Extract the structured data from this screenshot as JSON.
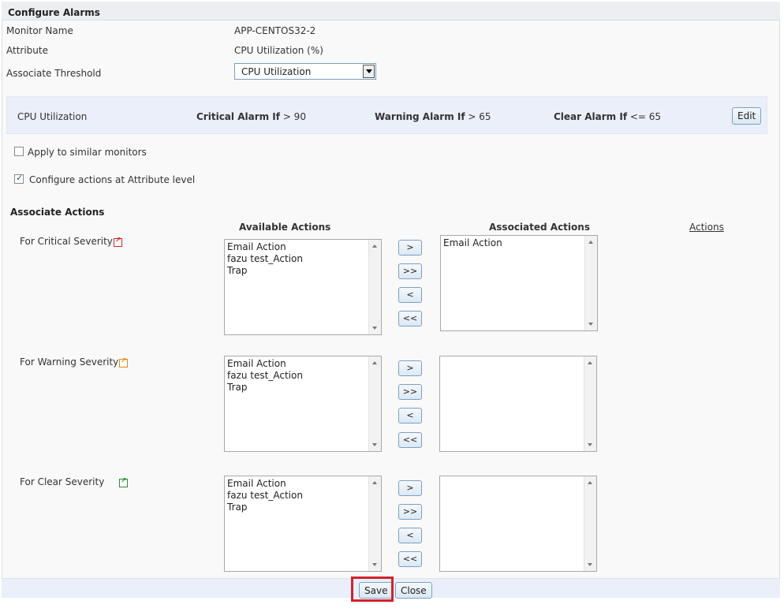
{
  "panel_title": "Configure Alarms",
  "fields": {
    "monitor_name_label": "Monitor Name",
    "monitor_name_value": "APP-CENTOS32-2",
    "attribute_label": "Attribute",
    "attribute_value": "CPU Utilization (%)",
    "threshold_label": "Associate Threshold",
    "threshold_selected": "CPU Utilization"
  },
  "threshold": {
    "name": "CPU Utilization",
    "critical_label": "Critical Alarm If",
    "critical_value": "> 90",
    "warning_label": "Warning Alarm If",
    "warning_value": "> 65",
    "clear_label": "Clear Alarm If",
    "clear_value": "<= 65",
    "edit_label": "Edit"
  },
  "options": {
    "apply_similar_label": "Apply to similar monitors",
    "apply_similar_checked": false,
    "configure_attr_label": "Configure actions at Attribute level",
    "configure_attr_checked": true
  },
  "actions": {
    "section_title": "Associate Actions",
    "available_header": "Available Actions",
    "associated_header": "Associated Actions",
    "actions_link": "Actions",
    "move_buttons": {
      "add": ">",
      "add_all": ">>",
      "remove": "<",
      "remove_all": "<<"
    },
    "severities": [
      {
        "label": "For Critical Severity",
        "available": [
          "Email Action",
          "fazu test_Action",
          "Trap"
        ],
        "associated": [
          "Email Action"
        ]
      },
      {
        "label": "For Warning Severity",
        "available": [
          "Email Action",
          "fazu test_Action",
          "Trap"
        ],
        "associated": []
      },
      {
        "label": "For Clear Severity",
        "available": [
          "Email Action",
          "fazu test_Action",
          "Trap"
        ],
        "associated": []
      }
    ]
  },
  "footer": {
    "save_label": "Save",
    "close_label": "Close"
  },
  "colors": {
    "critical": "#d9252b",
    "warning": "#e58a14",
    "clear": "#2e8b2e",
    "highlight": "#d3222a"
  }
}
